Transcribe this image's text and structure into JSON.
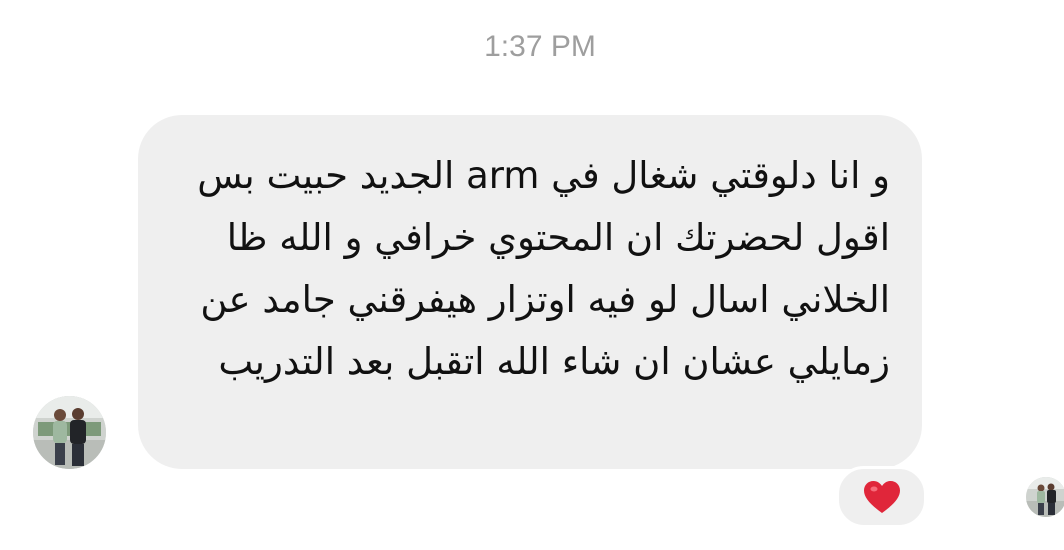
{
  "conversation": {
    "timestamp": "1:37 PM",
    "message": {
      "text": "و انا دلوقتي شغال في arm الجديد حبيت بس اقول لحضرتك ان المحتوي خرافي و الله ظا الخلاني اسال لو فيه اوتزار هيفرقني جامد عن زمايلي عشان ان شاء الله اتقبل بعد التدريب",
      "reaction": "heart"
    }
  },
  "icons": {
    "reaction_icon": "heart-icon",
    "reaction_color": "#e0263a"
  },
  "colors": {
    "bubble_bg": "#efefef",
    "timestamp": "#9e9e9e",
    "text": "#111111"
  }
}
